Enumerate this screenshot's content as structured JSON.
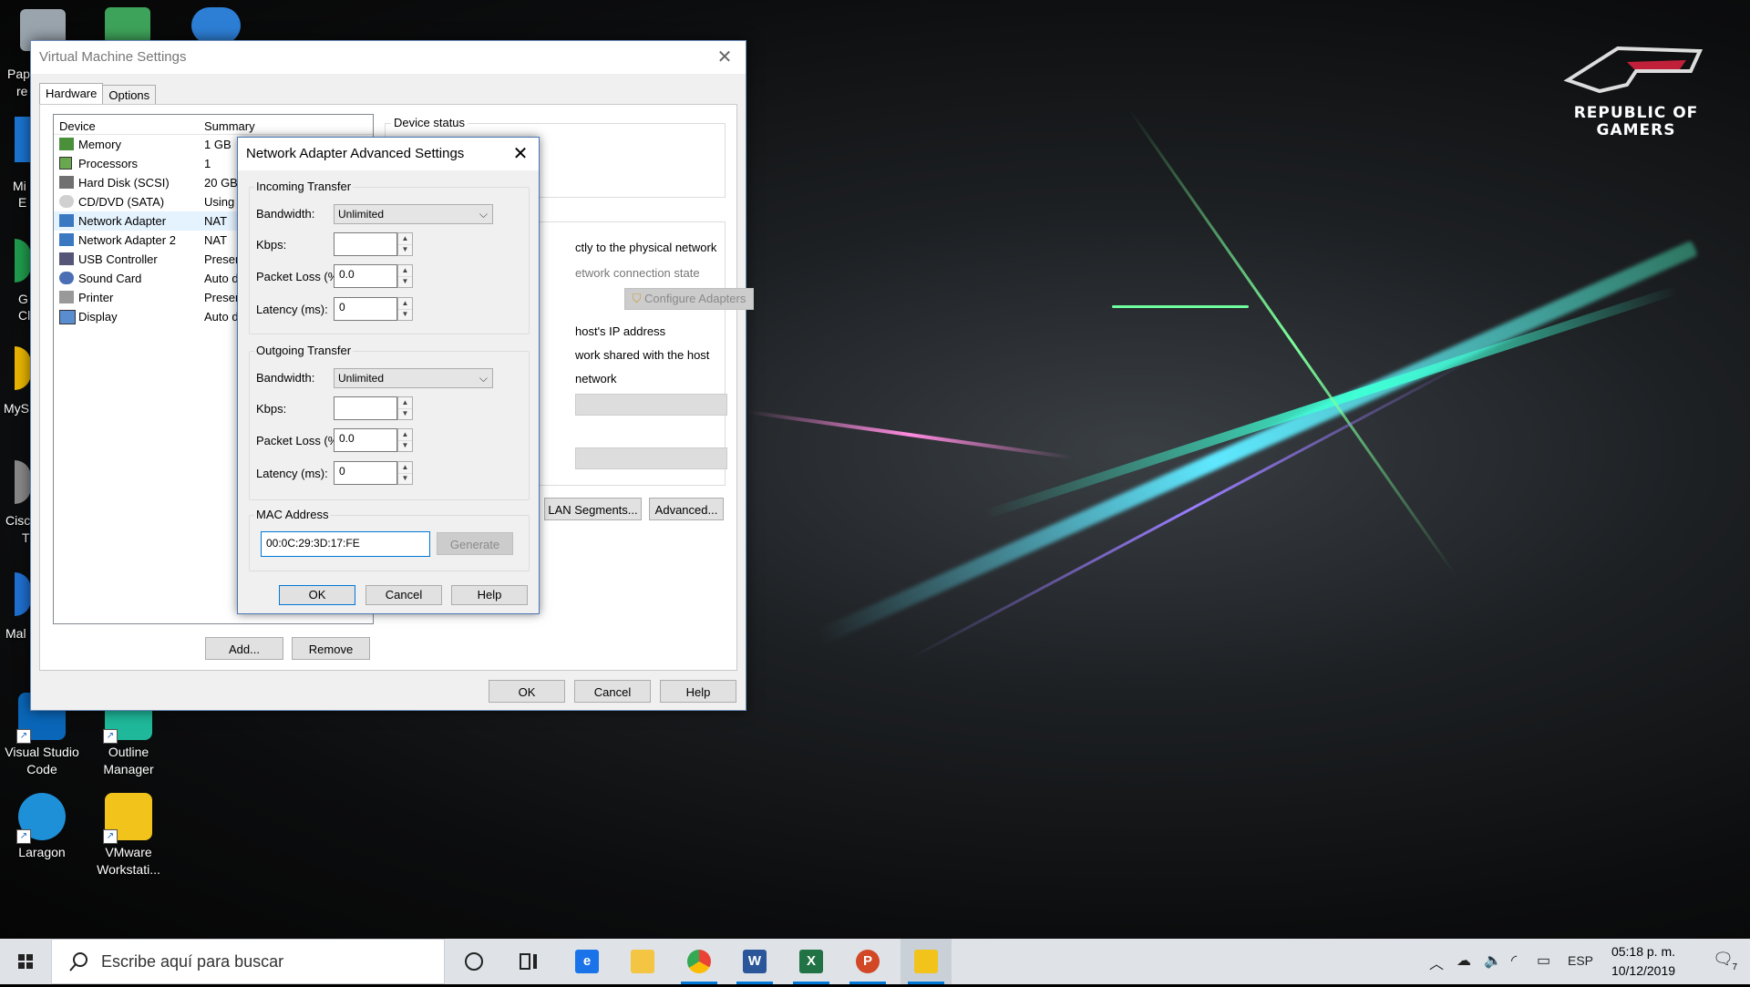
{
  "desktop": {
    "brand_line1": "REPUBLIC OF",
    "brand_line2": "GAMERS",
    "icons": [
      {
        "label1": "Visual Studio",
        "label2": "Code"
      },
      {
        "label1": "Outline",
        "label2": "Manager"
      },
      {
        "label1": "Laragon",
        "label2": ""
      },
      {
        "label1": "VMware",
        "label2": "Workstati..."
      }
    ],
    "edge_labels": [
      "Pap",
      "re",
      "Mi",
      "E",
      "G",
      "Cl",
      "MyS",
      "Cisc",
      "T",
      "Mal"
    ]
  },
  "vm_window": {
    "title": "Virtual Machine Settings",
    "tabs": [
      "Hardware",
      "Options"
    ],
    "device_col": "Device",
    "summary_col": "Summary",
    "devices": [
      {
        "name": "Memory",
        "summary": "1 GB"
      },
      {
        "name": "Processors",
        "summary": "1"
      },
      {
        "name": "Hard Disk (SCSI)",
        "summary": "20 GB"
      },
      {
        "name": "CD/DVD (SATA)",
        "summary": "Using fi"
      },
      {
        "name": "Network Adapter",
        "summary": "NAT"
      },
      {
        "name": "Network Adapter 2",
        "summary": "NAT"
      },
      {
        "name": "USB Controller",
        "summary": "Presen"
      },
      {
        "name": "Sound Card",
        "summary": "Auto de"
      },
      {
        "name": "Printer",
        "summary": "Present"
      },
      {
        "name": "Display",
        "summary": "Auto de"
      }
    ],
    "add_button": "Add...",
    "remove_button": "Remove",
    "device_status": "Device status",
    "net_lines": [
      "ctly to the physical network",
      "etwork connection state",
      "host's IP address",
      "work shared with the host",
      "network"
    ],
    "configure_adapters": "Configure Adapters",
    "lan_segments": "LAN Segments...",
    "advanced": "Advanced...",
    "ok": "OK",
    "cancel": "Cancel",
    "help": "Help"
  },
  "adv_dialog": {
    "title": "Network Adapter Advanced Settings",
    "incoming": {
      "title": "Incoming Transfer",
      "bandwidth_label": "Bandwidth:",
      "bandwidth_value": "Unlimited",
      "kbps_label": "Kbps:",
      "kbps_value": "",
      "loss_label": "Packet Loss (%):",
      "loss_value": "0.0",
      "latency_label": "Latency (ms):",
      "latency_value": "0"
    },
    "outgoing": {
      "title": "Outgoing Transfer",
      "bandwidth_label": "Bandwidth:",
      "bandwidth_value": "Unlimited",
      "kbps_label": "Kbps:",
      "kbps_value": "",
      "loss_label": "Packet Loss (%):",
      "loss_value": "0.0",
      "latency_label": "Latency (ms):",
      "latency_value": "0"
    },
    "mac_title": "MAC Address",
    "mac_value": "00:0C:29:3D:17:FE",
    "generate": "Generate",
    "ok": "OK",
    "cancel": "Cancel",
    "help": "Help"
  },
  "taskbar": {
    "search_placeholder": "Escribe aquí para buscar",
    "language": "ESP",
    "time": "05:18 p. m.",
    "date": "10/12/2019",
    "notification_count": "7"
  }
}
